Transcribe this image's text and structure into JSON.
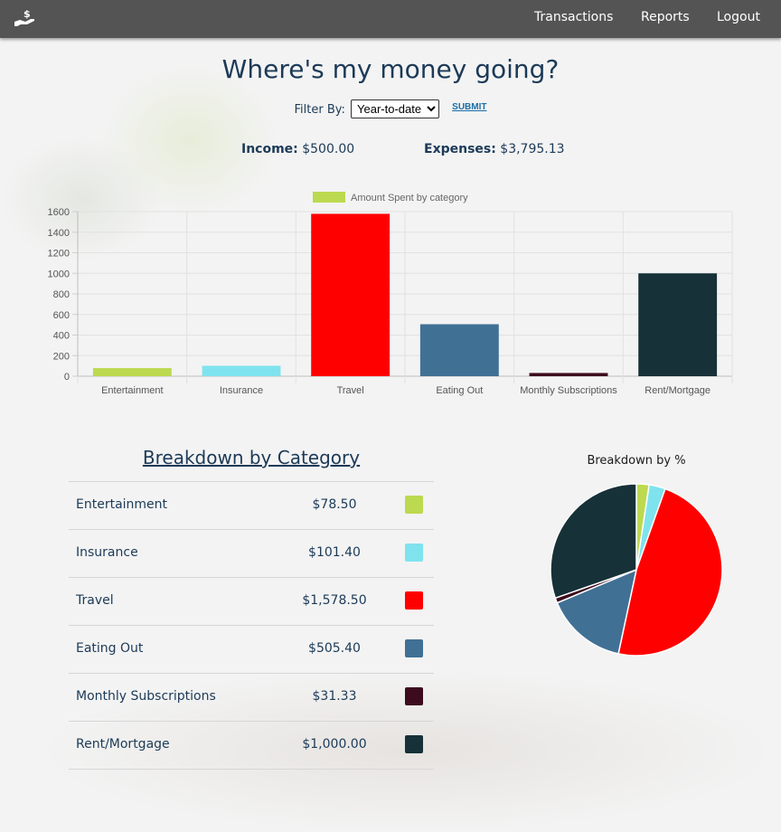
{
  "nav": {
    "logo_icon": "hand-holding-dollar-icon",
    "links": [
      "Transactions",
      "Reports",
      "Logout"
    ]
  },
  "page": {
    "title": "Where's my money going?"
  },
  "filter": {
    "label": "Filter By:",
    "options": [
      "Year-to-date"
    ],
    "selected": "Year-to-date",
    "submit_label": "SUBMIT"
  },
  "totals": {
    "income_label": "Income:",
    "income_value": "$500.00",
    "expenses_label": "Expenses:",
    "expenses_value": "$3,795.13"
  },
  "colors": {
    "Entertainment": "#bcd94f",
    "Insurance": "#7fe3ee",
    "Travel": "#ff0000",
    "Eating Out": "#417095",
    "Monthly Subscriptions": "#3d0b1e",
    "Rent/Mortgage": "#163137"
  },
  "chart_data": [
    {
      "type": "bar",
      "categories": [
        "Entertainment",
        "Insurance",
        "Travel",
        "Eating Out",
        "Monthly Subscriptions",
        "Rent/Mortgage"
      ],
      "series": [
        {
          "name": "Amount Spent by category",
          "values": [
            78.5,
            101.4,
            1578.5,
            505.4,
            31.33,
            1000.0
          ]
        }
      ],
      "yticks": [
        0,
        200,
        400,
        600,
        800,
        1000,
        1200,
        1400,
        1600
      ],
      "ylim": [
        0,
        1600
      ],
      "grid": true,
      "legend": "top"
    },
    {
      "type": "pie",
      "title": "Breakdown by %",
      "labels": [
        "Entertainment",
        "Insurance",
        "Travel",
        "Eating Out",
        "Monthly Subscriptions",
        "Rent/Mortgage"
      ],
      "values": [
        78.5,
        101.4,
        1578.5,
        505.4,
        31.33,
        1000.0
      ]
    }
  ],
  "breakdown": {
    "title": "Breakdown by Category",
    "rows": [
      {
        "name": "Entertainment",
        "amount": "$78.50"
      },
      {
        "name": "Insurance",
        "amount": "$101.40"
      },
      {
        "name": "Travel",
        "amount": "$1,578.50"
      },
      {
        "name": "Eating Out",
        "amount": "$505.40"
      },
      {
        "name": "Monthly Subscriptions",
        "amount": "$31.33"
      },
      {
        "name": "Rent/Mortgage",
        "amount": "$1,000.00"
      }
    ]
  }
}
